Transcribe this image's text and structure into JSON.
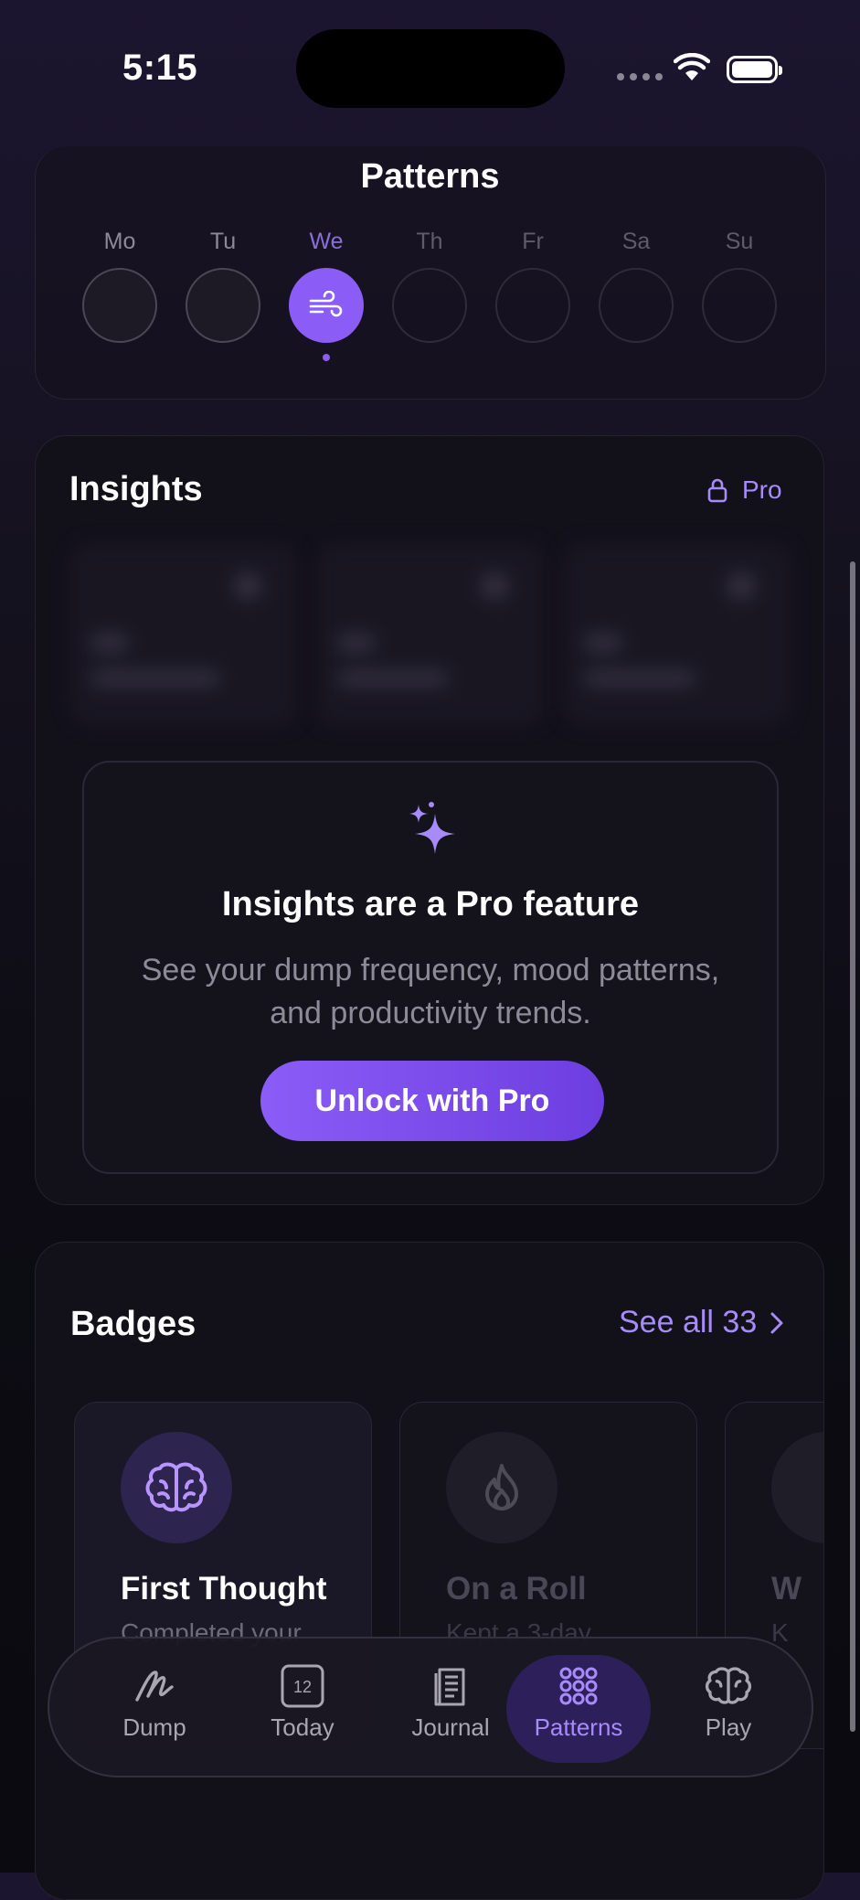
{
  "status_bar": {
    "time": "5:15"
  },
  "header": {
    "title": "Patterns"
  },
  "week": {
    "days": [
      {
        "label": "Mo",
        "state": "logged"
      },
      {
        "label": "Tu",
        "state": "logged"
      },
      {
        "label": "We",
        "state": "today",
        "icon": "wind-icon"
      },
      {
        "label": "Th",
        "state": "future"
      },
      {
        "label": "Fr",
        "state": "future"
      },
      {
        "label": "Sa",
        "state": "future"
      },
      {
        "label": "Su",
        "state": "future"
      }
    ]
  },
  "insights": {
    "title": "Insights",
    "pro_label": "Pro",
    "locked_headline": "Insights are a Pro feature",
    "locked_line1": "See your dump frequency, mood patterns,",
    "locked_line2": "and productivity trends.",
    "unlock_label": "Unlock with Pro"
  },
  "badges": {
    "title": "Badges",
    "see_all_label": "See all 33",
    "items": [
      {
        "name": "First Thought",
        "desc": "Completed your",
        "unlocked": true,
        "icon": "brain-icon"
      },
      {
        "name": "On a Roll",
        "desc": "Kept a 3-day",
        "unlocked": false,
        "icon": "flame-icon"
      },
      {
        "name": "W",
        "desc": "K",
        "unlocked": false,
        "icon": "badge-icon"
      }
    ]
  },
  "tabs": [
    {
      "label": "Dump",
      "icon": "scribble-icon",
      "active": false
    },
    {
      "label": "Today",
      "icon": "calendar-icon",
      "active": false,
      "icon_text": "12"
    },
    {
      "label": "Journal",
      "icon": "notebook-icon",
      "active": false
    },
    {
      "label": "Patterns",
      "icon": "grid-dots-icon",
      "active": true
    },
    {
      "label": "Play",
      "icon": "brain-icon",
      "active": false
    }
  ],
  "colors": {
    "accent": "#8b5cf6",
    "accent_text": "#a78bfa",
    "background": "#0d0c14"
  }
}
